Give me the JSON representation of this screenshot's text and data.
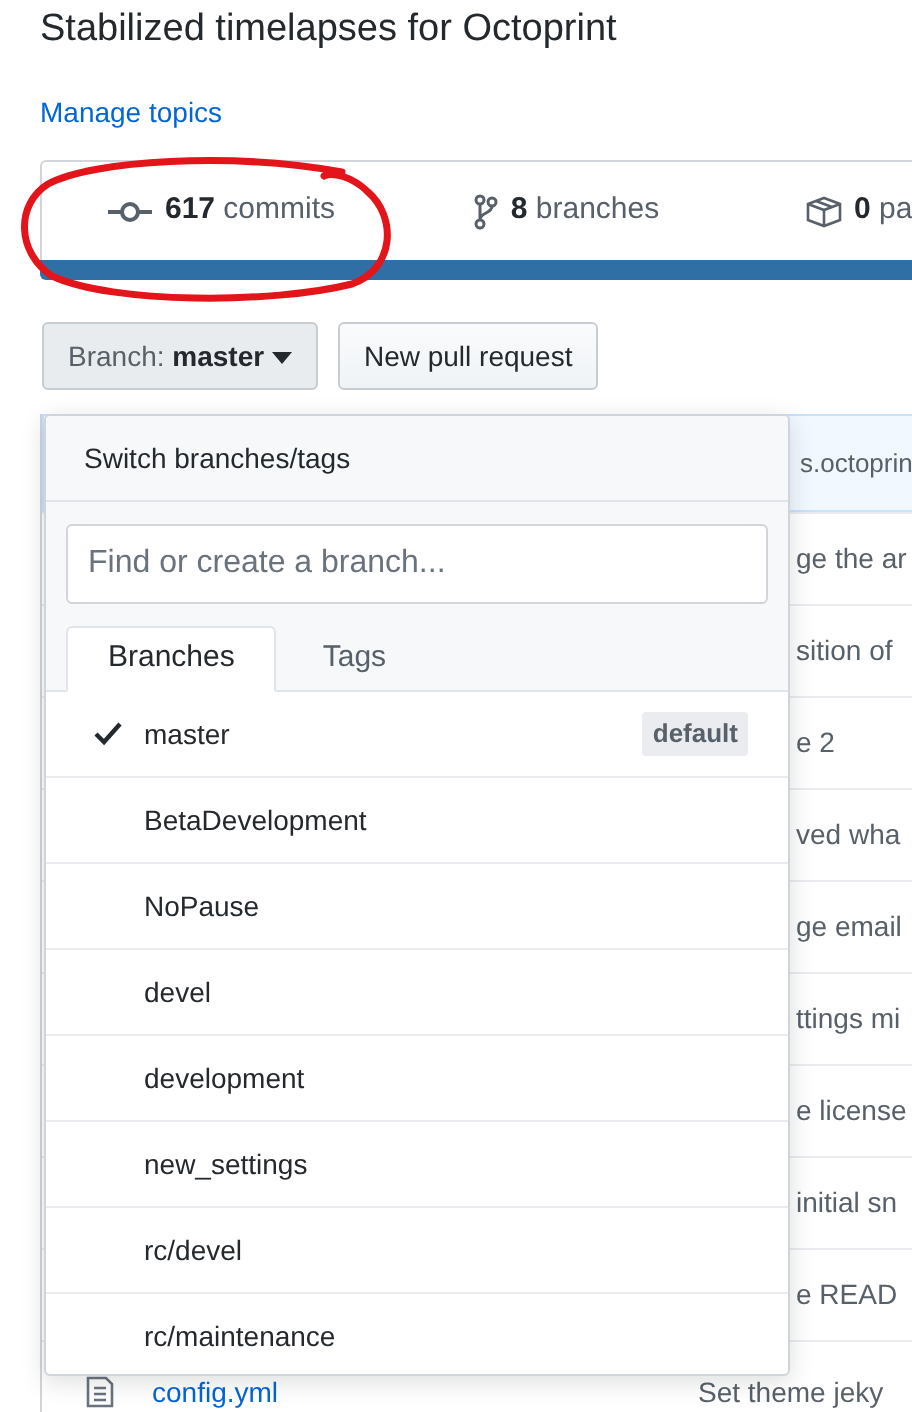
{
  "repo": {
    "description": "Stabilized timelapses for Octoprint",
    "manage_topics": "Manage topics"
  },
  "stats": [
    {
      "kind": "commits",
      "count": "617",
      "label": "commits"
    },
    {
      "kind": "branches",
      "count": "8",
      "label": "branches"
    },
    {
      "kind": "packages",
      "count": "0",
      "label": "pa"
    }
  ],
  "branch_button": {
    "label": "Branch:",
    "value": "master"
  },
  "new_pull_request": "New pull request",
  "branch_menu": {
    "title": "Switch branches/tags",
    "search": {
      "placeholder": "Find or create a branch..."
    },
    "tabs": [
      {
        "label": "Branches",
        "selected": true
      },
      {
        "label": "Tags",
        "selected": false
      }
    ],
    "branches": [
      {
        "name": "master",
        "checked": true,
        "badge": "default"
      },
      {
        "name": "BetaDevelopment",
        "checked": false
      },
      {
        "name": "NoPause",
        "checked": false
      },
      {
        "name": "devel",
        "checked": false
      },
      {
        "name": "development",
        "checked": false
      },
      {
        "name": "new_settings",
        "checked": false
      },
      {
        "name": "rc/devel",
        "checked": false
      },
      {
        "name": "rc/maintenance",
        "checked": false
      }
    ]
  },
  "files": [
    {
      "kind": "commit",
      "message": "s.octoprin"
    },
    {
      "kind": "covered",
      "message": "ge the ar"
    },
    {
      "kind": "covered",
      "message": "sition of"
    },
    {
      "kind": "covered",
      "message": "e 2"
    },
    {
      "kind": "covered",
      "message": "ved wha"
    },
    {
      "kind": "covered",
      "message": "ge email"
    },
    {
      "kind": "covered",
      "message": "ttings mi"
    },
    {
      "kind": "covered",
      "message": "e license"
    },
    {
      "kind": "covered",
      "message": "initial sn"
    },
    {
      "kind": "covered",
      "message": "e READ"
    },
    {
      "kind": "file",
      "name": "config.yml",
      "message": "Set theme jeky"
    }
  ]
}
